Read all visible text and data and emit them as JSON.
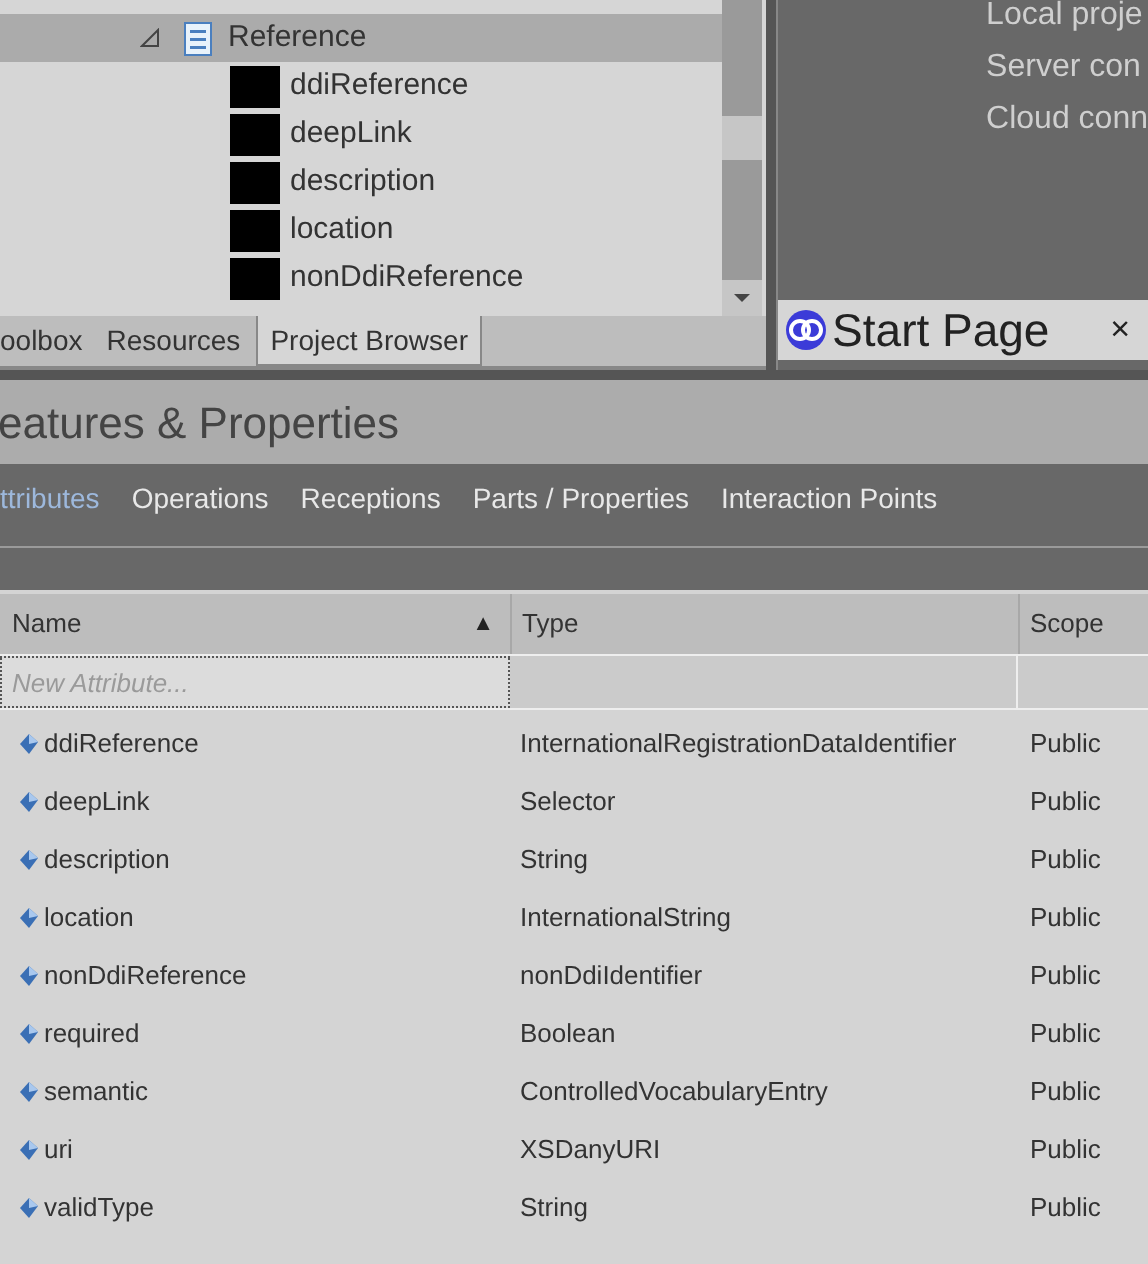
{
  "project_browser": {
    "tree": [
      {
        "label": "Reference",
        "expanded": true,
        "selected": true,
        "children": [
          {
            "label": "ddiReference"
          },
          {
            "label": "deepLink"
          },
          {
            "label": "description"
          },
          {
            "label": "location"
          },
          {
            "label": "nonDdiReference"
          }
        ]
      }
    ],
    "tabs": [
      {
        "label": "oolbox",
        "selected": false
      },
      {
        "label": "Resources",
        "selected": false
      },
      {
        "label": "Project Browser",
        "selected": true
      }
    ]
  },
  "start_page": {
    "links": [
      "Local proje",
      "Server con",
      "Cloud conn"
    ],
    "tab": {
      "label": "Start Page",
      "close": "×"
    }
  },
  "features": {
    "title": "eatures & Properties",
    "tabs": [
      {
        "label": "ttributes",
        "selected": true
      },
      {
        "label": "Operations",
        "selected": false
      },
      {
        "label": "Receptions",
        "selected": false
      },
      {
        "label": "Parts / Properties",
        "selected": false
      },
      {
        "label": "Interaction Points",
        "selected": false
      }
    ],
    "table": {
      "columns": [
        "Name",
        "Type",
        "Scope"
      ],
      "sort": "▲",
      "new_row": {
        "placeholder": "New Attribute..."
      },
      "rows": [
        {
          "name": "ddiReference",
          "type": "InternationalRegistrationDataIdentifier",
          "scope": "Public"
        },
        {
          "name": "deepLink",
          "type": "Selector",
          "scope": "Public"
        },
        {
          "name": "description",
          "type": "String",
          "scope": "Public"
        },
        {
          "name": "location",
          "type": "InternationalString",
          "scope": "Public"
        },
        {
          "name": "nonDdiReference",
          "type": "nonDdiIdentifier",
          "scope": "Public"
        },
        {
          "name": "required",
          "type": "Boolean",
          "scope": "Public"
        },
        {
          "name": "semantic",
          "type": "ControlledVocabularyEntry",
          "scope": "Public"
        },
        {
          "name": "uri",
          "type": "XSDanyURI",
          "scope": "Public"
        },
        {
          "name": "validType",
          "type": "String",
          "scope": "Public"
        }
      ]
    }
  }
}
